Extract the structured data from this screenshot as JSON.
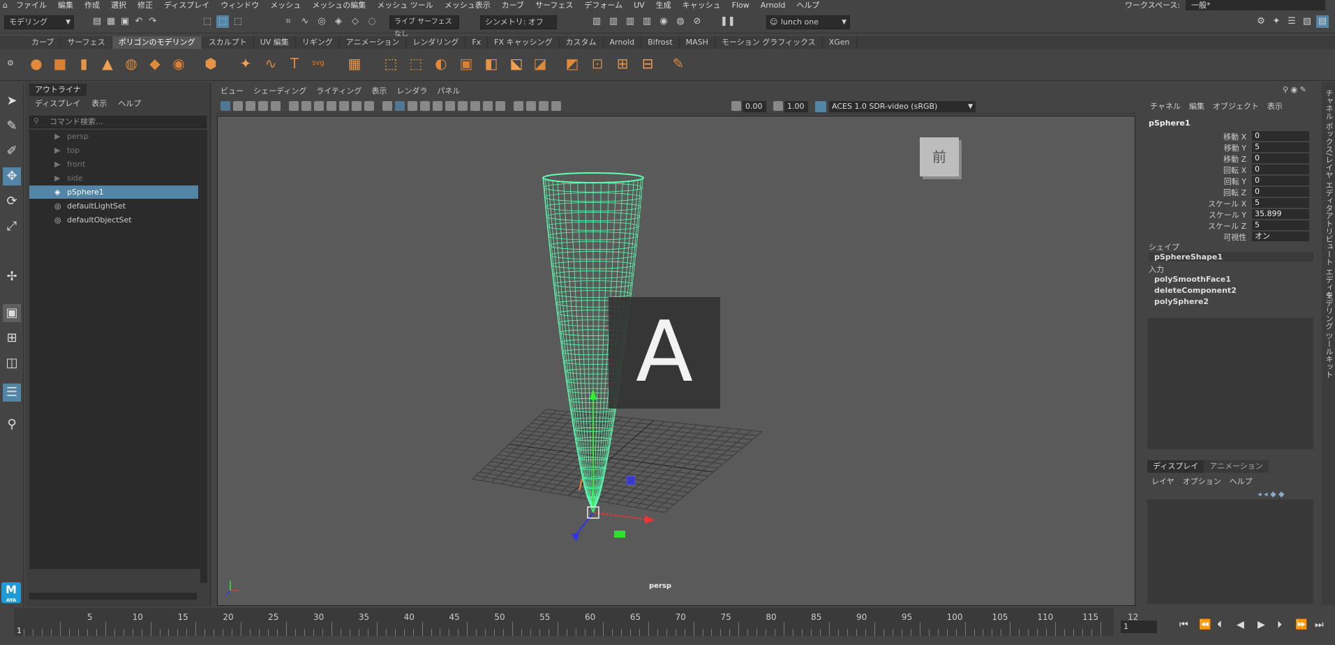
{
  "menubar": {
    "items": [
      "ファイル",
      "編集",
      "作成",
      "選択",
      "修正",
      "ディスプレイ",
      "ウィンドウ",
      "メッシュ",
      "メッシュの編集",
      "メッシュ ツール",
      "メッシュ表示",
      "カーブ",
      "サーフェス",
      "デフォーム",
      "UV",
      "生成",
      "キャッシュ",
      "Flow",
      "Arnold",
      "ヘルプ"
    ],
    "workspace_label": "ワークスペース:",
    "workspace_value": "一般*"
  },
  "statusline": {
    "mode": "モデリング",
    "live_label": "ライブ",
    "live_value": "サーフェスなし",
    "symmetry": "シンメトリ: オフ",
    "user": "lunch one"
  },
  "shelf": {
    "tabs": [
      "カーブ",
      "サーフェス",
      "ポリゴンのモデリング",
      "スカルプト",
      "UV 編集",
      "リギング",
      "アニメーション",
      "レンダリング",
      "Fx",
      "FX キャッシング",
      "カスタム",
      "Arnold",
      "Bifrost",
      "MASH",
      "モーション グラフィックス",
      "XGen"
    ],
    "active_index": 2,
    "icon_names": [
      "sphere-icon",
      "cube-icon",
      "cylinder-icon",
      "cone-icon",
      "torus-icon",
      "plane-icon",
      "disc-icon",
      "platonic-icon",
      "star-icon",
      "helix-icon",
      "text-icon",
      "svg-icon",
      "uv-grid-icon",
      "combine-icon",
      "separate-icon",
      "smooth-icon",
      "mirror-icon",
      "extrude-icon",
      "bridge-icon",
      "bevel-icon",
      "fill-hole-icon",
      "multi-cut-icon",
      "insert-loop-icon",
      "offset-loop-icon",
      "target-weld-icon"
    ]
  },
  "outliner": {
    "tab": "アウトライナ",
    "menu": [
      "ディスプレイ",
      "表示",
      "ヘルプ"
    ],
    "search_placeholder": "コマンド検索...",
    "items": [
      {
        "label": "persp",
        "type": "camera",
        "dim": true
      },
      {
        "label": "top",
        "type": "camera",
        "dim": true
      },
      {
        "label": "front",
        "type": "camera",
        "dim": true
      },
      {
        "label": "side",
        "type": "camera",
        "dim": true
      },
      {
        "label": "pSphere1",
        "type": "mesh",
        "selected": true
      },
      {
        "label": "defaultLightSet",
        "type": "set"
      },
      {
        "label": "defaultObjectSet",
        "type": "set"
      }
    ]
  },
  "viewport": {
    "menu": [
      "ビュー",
      "シェーディング",
      "ライティング",
      "表示",
      "レンダラ",
      "パネル"
    ],
    "exposure": "0.00",
    "gamma": "1.00",
    "colorspace": "ACES 1.0 SDR-video (sRGB)",
    "camera": "persp",
    "viewcube_face": "前",
    "overlay_letter": "A",
    "wire_color": "#5dffb0"
  },
  "channelbox": {
    "menu": [
      "チャネル",
      "編集",
      "オブジェクト",
      "表示"
    ],
    "object": "pSphere1",
    "attributes": [
      {
        "name": "移動 X",
        "value": "0"
      },
      {
        "name": "移動 Y",
        "value": "5"
      },
      {
        "name": "移動 Z",
        "value": "0"
      },
      {
        "name": "回転 X",
        "value": "0"
      },
      {
        "name": "回転 Y",
        "value": "0"
      },
      {
        "name": "回転 Z",
        "value": "0"
      },
      {
        "name": "スケール X",
        "value": "5"
      },
      {
        "name": "スケール Y",
        "value": "35.899"
      },
      {
        "name": "スケール Z",
        "value": "5"
      },
      {
        "name": "可視性",
        "value": "オン"
      }
    ],
    "shape_label": "シェイプ",
    "shape": "pSphereShape1",
    "input_label": "入力",
    "inputs": [
      "polySmoothFace1",
      "deleteComponent2",
      "polySphere2"
    ]
  },
  "layers": {
    "tabs": [
      "ディスプレイ",
      "アニメーション"
    ],
    "menu": [
      "レイヤ",
      "オプション",
      "ヘルプ"
    ]
  },
  "side_tabs": [
    "チャネル ボックス/レイヤ エディタ",
    "アトリビュート エディタ",
    "モデリング ツールキット"
  ],
  "timeline": {
    "ticks": [
      "5",
      "10",
      "15",
      "20",
      "25",
      "30",
      "35",
      "40",
      "45",
      "50",
      "55",
      "60",
      "65",
      "70",
      "75",
      "80",
      "85",
      "90",
      "95",
      "100",
      "105",
      "110",
      "115",
      "12"
    ],
    "start_frame": "1",
    "current_frame": "1"
  },
  "logo": {
    "text": "M",
    "sub": "AYA"
  }
}
